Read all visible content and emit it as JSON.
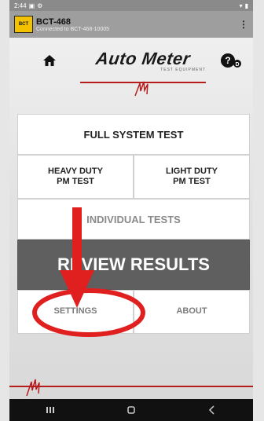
{
  "status_bar": {
    "time": "2:44",
    "icons_left": [
      "notification-icon",
      "settings-icon"
    ],
    "icons_right": [
      "signal-icon",
      "battery-icon"
    ]
  },
  "app_bar": {
    "device_name": "BCT-468",
    "connection_status": "Connected to BCT-468-10005",
    "logo_icon": "autometer-device-icon",
    "menu_icon": "more-vert-icon"
  },
  "header": {
    "home_icon": "home-icon",
    "help_icon": "help-icon",
    "logo_text": "Auto Meter",
    "logo_subtext": "TEST EQUIPMENT"
  },
  "menu": {
    "full_system_test": "FULL SYSTEM TEST",
    "heavy_duty_line1": "HEAVY DUTY",
    "heavy_duty_line2": "PM TEST",
    "light_duty_line1": "LIGHT DUTY",
    "light_duty_line2": "PM TEST",
    "individual_tests": "INDIVIDUAL TESTS",
    "review_results": "REVIEW RESULTS",
    "settings": "SETTINGS",
    "about": "ABOUT"
  },
  "annotation": {
    "color": "#e01f1f",
    "arrow_icon": "arrow-down-icon",
    "highlight_icon": "ellipse-highlight-icon"
  },
  "nav_bar": {
    "icons": [
      "recent-apps-icon",
      "home-nav-icon",
      "back-icon"
    ]
  },
  "colors": {
    "brand_red": "#b71c1c",
    "review_bg": "#5f5f5f",
    "app_bar_bg": "#9e9e9e"
  }
}
